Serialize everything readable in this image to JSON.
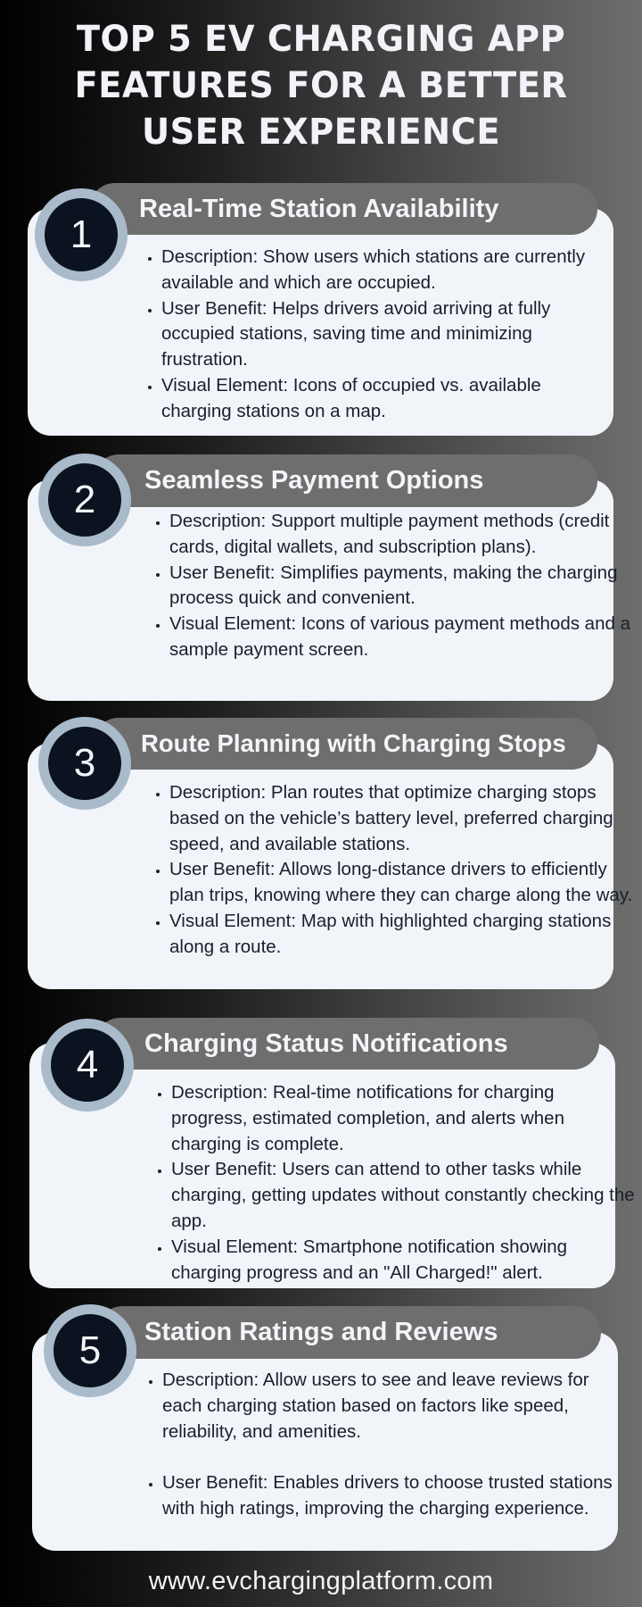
{
  "title": {
    "line1": "TOP 5 EV CHARGING APP",
    "line2": "FEATURES FOR A BETTER",
    "line3": "USER EXPERIENCE"
  },
  "features": [
    {
      "number": "1",
      "title": "Real-Time Station Availability",
      "bullets": [
        "Description: Show users which stations are currently available and which are occupied.",
        "User Benefit: Helps drivers avoid arriving at fully occupied stations, saving time and minimizing frustration.",
        "Visual Element: Icons of occupied vs. available charging stations on a map."
      ]
    },
    {
      "number": "2",
      "title": "Seamless Payment Options",
      "bullets": [
        "Description: Support multiple payment methods (credit cards, digital wallets, and subscription plans).",
        "User Benefit: Simplifies payments, making the charging process quick and convenient.",
        "Visual Element: Icons of various payment methods and a sample payment screen."
      ]
    },
    {
      "number": "3",
      "title": "Route Planning with Charging Stops",
      "bullets": [
        "Description: Plan routes that optimize charging stops based on the vehicle’s battery level, preferred charging speed, and available stations.",
        "User Benefit: Allows long-distance drivers to efficiently plan trips, knowing where they can charge along the way.",
        "Visual Element: Map with highlighted charging stations along a route."
      ]
    },
    {
      "number": "4",
      "title": "Charging Status Notifications",
      "bullets": [
        "Description: Real-time notifications for charging progress, estimated completion, and alerts when charging is complete.",
        "User Benefit: Users can attend to other tasks while charging, getting updates without constantly checking the app.",
        "Visual Element: Smartphone notification showing charging progress and an \"All Charged!\" alert."
      ]
    },
    {
      "number": "5",
      "title": "Station Ratings and Reviews",
      "bullets": [
        "Description: Allow users to see and leave reviews for each charging station based on factors like speed, reliability, and amenities.",
        "User Benefit: Enables drivers to choose trusted stations with high ratings, improving the charging experience."
      ]
    }
  ],
  "footer": {
    "url": "www.evchargingplatform.com"
  },
  "colors": {
    "header_bar": "#6e6e6e",
    "card_body": "#f1f4f9",
    "circle_ring": "#a9bacb",
    "circle_fill": "#0b1320",
    "text_light": "#f1f3f8",
    "text_dark": "#1a1f2b"
  }
}
